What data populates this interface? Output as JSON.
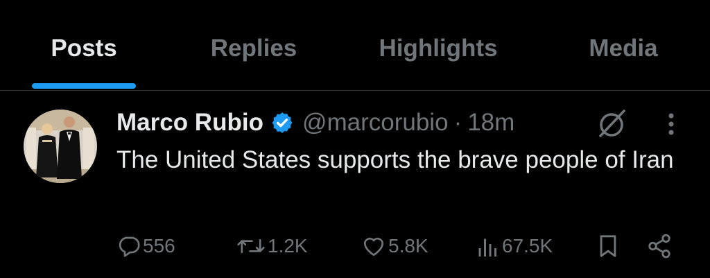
{
  "tabs": [
    {
      "label": "Posts",
      "active": true
    },
    {
      "label": "Replies",
      "active": false
    },
    {
      "label": "Highlights",
      "active": false
    },
    {
      "label": "Media",
      "active": false
    }
  ],
  "post": {
    "author_name": "Marco Rubio",
    "verified_icon": "verified-badge-icon",
    "handle": "@marcorubio",
    "separator": "·",
    "time": "18m",
    "text": "The United States supports the brave people of Iran",
    "actions": {
      "replies": "556",
      "reposts": "1.2K",
      "likes": "5.8K",
      "views": "67.5K"
    }
  },
  "colors": {
    "background": "#000000",
    "primary_text": "#e7e9ea",
    "secondary_text": "#71767b",
    "accent": "#1d9bf0",
    "divider": "#2f3336"
  }
}
